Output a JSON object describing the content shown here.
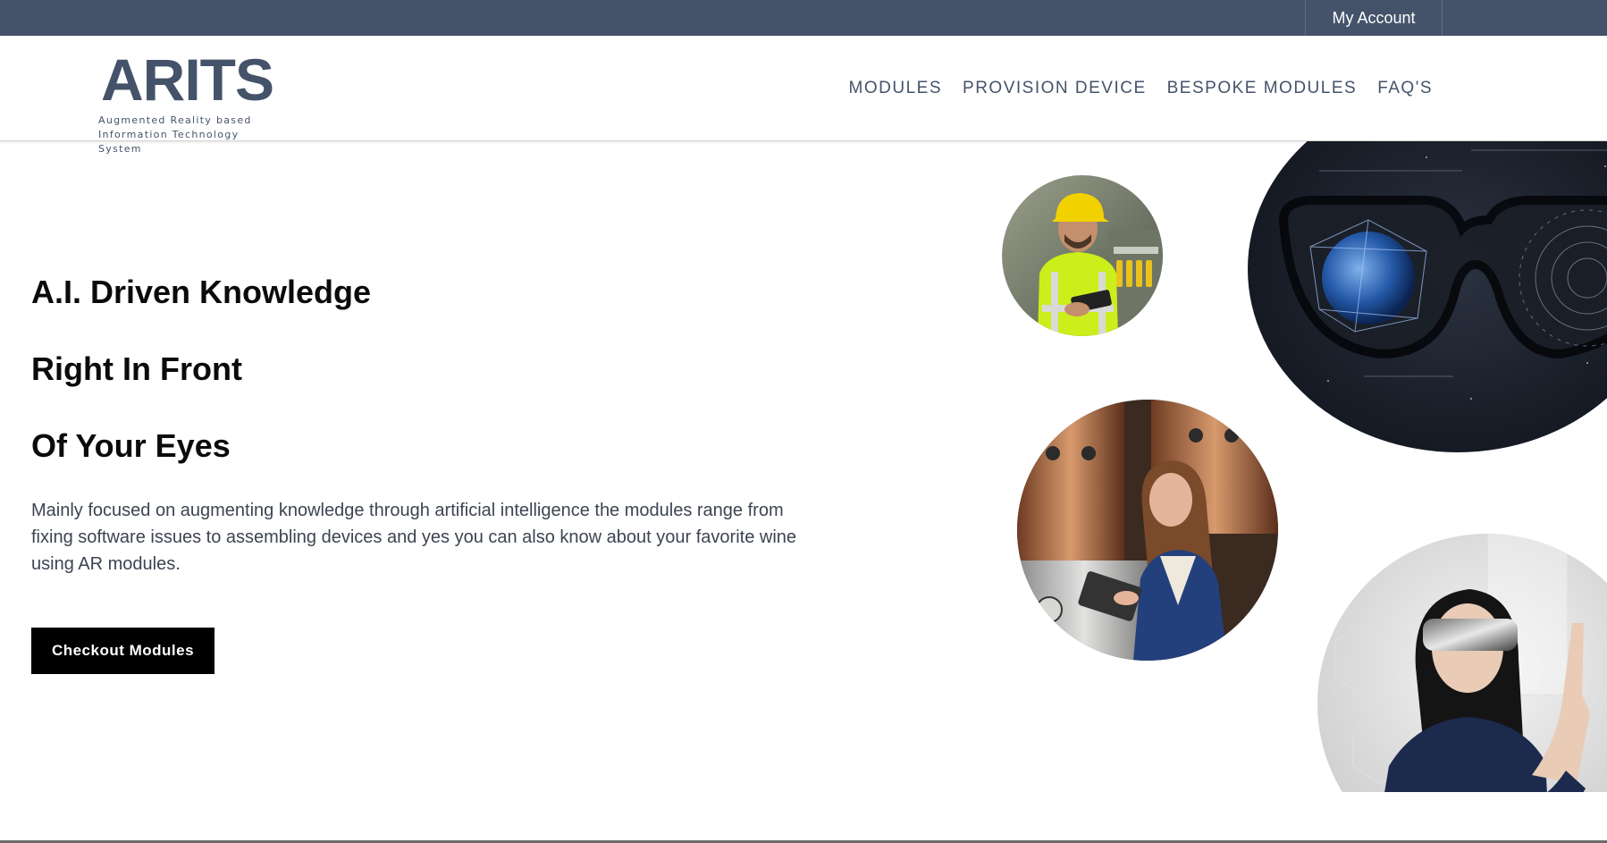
{
  "topbar": {
    "account_label": "My Account",
    "color": "#44536a"
  },
  "logo": {
    "word": "ARITS",
    "line1": "Augmented Reality based",
    "line2": "Information Technology System"
  },
  "nav": [
    {
      "label": "MODULES"
    },
    {
      "label": "PROVISION DEVICE"
    },
    {
      "label": "BESPOKE MODULES"
    },
    {
      "label": "FAQ'S"
    }
  ],
  "hero": {
    "title_lines": [
      "A.I. Driven Knowledge",
      "Right In Front",
      "Of Your Eyes"
    ],
    "description": "Mainly focused on augmenting knowledge through artificial intelligence the modules range from fixing software issues to assembling devices and yes you can also know about your favorite wine using AR modules.",
    "cta_label": "Checkout Modules"
  },
  "images": [
    {
      "name": "worker-hardhat-image",
      "depicts": "worker in yellow hard hat and safety vest using tablet"
    },
    {
      "name": "ar-glasses-image",
      "depicts": "futuristic glasses with earth hologram on dark space background"
    },
    {
      "name": "brewery-woman-image",
      "depicts": "woman with tablet next to copper brewery tanks"
    },
    {
      "name": "vr-woman-image",
      "depicts": "woman wearing AR visor touching virtual screen"
    }
  ]
}
